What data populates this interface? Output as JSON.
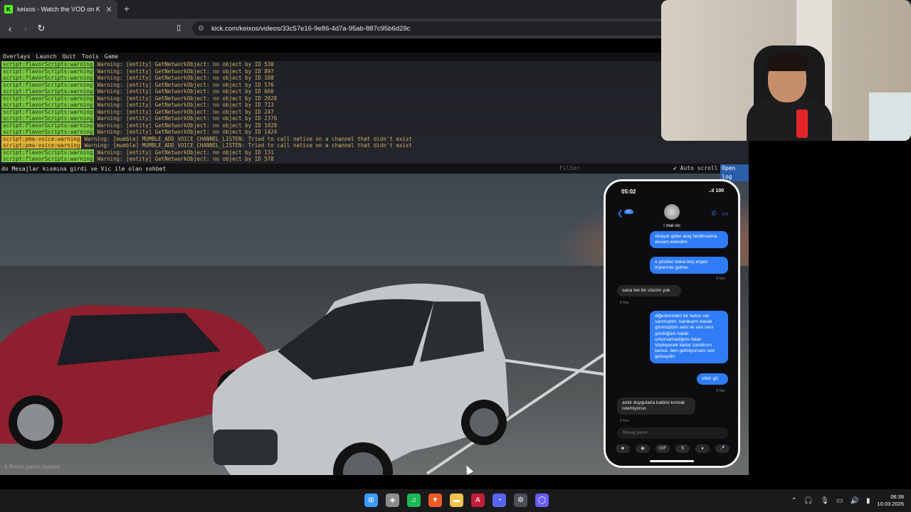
{
  "browser": {
    "tab_title": "keixos - Watch the VOD on K",
    "favicon_letter": "K",
    "url": "kick.com/keixos/videos/33c57e16-9e86-4d7a-95ab-887c95b6d29c"
  },
  "console": {
    "menu": [
      "Overlays",
      "Launch",
      "Quit",
      "Tools",
      "Game"
    ],
    "logs": [
      {
        "tag": "script:flavorScripts:warning",
        "text": "Warning: [entity] GetNetworkObject: no object by ID 530",
        "kind": "flavor"
      },
      {
        "tag": "script:flavorScripts:warning",
        "text": "Warning: [entity] GetNetworkObject: no object by ID 897",
        "kind": "flavor"
      },
      {
        "tag": "script:flavorScripts:warning",
        "text": "Warning: [entity] GetNetworkObject: no object by ID 188",
        "kind": "flavor"
      },
      {
        "tag": "script:flavorScripts:warning",
        "text": "Warning: [entity] GetNetworkObject: no object by ID 576",
        "kind": "flavor"
      },
      {
        "tag": "script:flavorScripts:warning",
        "text": "Warning: [entity] GetNetworkObject: no object by ID 666",
        "kind": "flavor"
      },
      {
        "tag": "script:flavorScripts:warning",
        "text": "Warning: [entity] GetNetworkObject: no object by ID 2028",
        "kind": "flavor"
      },
      {
        "tag": "script:flavorScripts:warning",
        "text": "Warning: [entity] GetNetworkObject: no object by ID 713",
        "kind": "flavor"
      },
      {
        "tag": "script:flavorScripts:warning",
        "text": "Warning: [entity] GetNetworkObject: no object by ID 247",
        "kind": "flavor"
      },
      {
        "tag": "script:flavorScripts:warning",
        "text": "Warning: [entity] GetNetworkObject: no object by ID 2376",
        "kind": "flavor"
      },
      {
        "tag": "script:flavorScripts:warning",
        "text": "Warning: [entity] GetNetworkObject: no object by ID 1028",
        "kind": "flavor"
      },
      {
        "tag": "script:flavorScripts:warning",
        "text": "Warning: [entity] GetNetworkObject: no object by ID 1424",
        "kind": "flavor"
      },
      {
        "tag": "script:pma-voice:warning",
        "text": "Warning: [mumble] MUMBLE_ADD_VOICE_CHANNEL_LISTEN: Tried to call native on a channel that didn't exist",
        "kind": "voice"
      },
      {
        "tag": "script:pma-voice:warning",
        "text": "Warning: [mumble] MUMBLE_ADD_VOICE_CHANNEL_LISTEN: Tried to call native on a channel that didn't exist",
        "kind": "voice"
      },
      {
        "tag": "script:flavorScripts:warning",
        "text": "Warning: [entity] GetNetworkObject: no object by ID 131",
        "kind": "flavor"
      },
      {
        "tag": "script:flavorScripts:warning",
        "text": "Warning: [entity] GetNetworkObject: no object by ID 578",
        "kind": "flavor"
      }
    ],
    "command": "do Mesajlar kısmına girdi ve Vic ile olan sohbet",
    "filter_placeholder": "Filter",
    "autoscroll": "✔ Auto scroll",
    "open_log": "Open log",
    "packs_loaded": "9 Rema packs loaded"
  },
  "phone": {
    "time": "05:02",
    "signal": "..ıl 100",
    "back_count": "37",
    "contact": "! mal vic",
    "messages": [
      {
        "dir": "out",
        "text": "olsaydı gider araç testlimatına devam ederdim."
      },
      {
        "dir": "out",
        "text": "o yüzden bana boş ergen triplerinle gelme."
      },
      {
        "dir": "ts",
        "text": "8 Mar"
      },
      {
        "dir": "in",
        "text": "sana tek bir sözüm yok"
      },
      {
        "dir": "ts",
        "text": "8 Mar"
      },
      {
        "dir": "out",
        "text": "diğerlerinden bir farkın var sanmıştım. kardeşim olarak görmüştüm seni ve sen seni gördüğüm halde umursamadığımı falan söyleyecek kadar zavallısın bence. ben gelmiyorsam sen gelseydin."
      },
      {
        "dir": "out",
        "text": "siktir git."
      },
      {
        "dir": "ts",
        "text": "8 Mar"
      },
      {
        "dir": "in",
        "text": "anlık duygularla kalbini kırmak istemiyoruo"
      },
      {
        "dir": "ts",
        "text": "8 Mar"
      }
    ],
    "composer_placeholder": "Mesaj yazın",
    "actions": [
      "☻",
      "◉",
      "GIF",
      "$",
      "●",
      "🎤"
    ]
  },
  "taskbar": {
    "icons": [
      "windows-start-icon",
      "shield-icon",
      "spotify-icon",
      "brave-icon",
      "file-explorer-icon",
      "app-a-icon",
      "discord-icon",
      "steam-icon",
      "app-circle-icon"
    ],
    "time": "06:38",
    "date": "10.03.2026"
  }
}
